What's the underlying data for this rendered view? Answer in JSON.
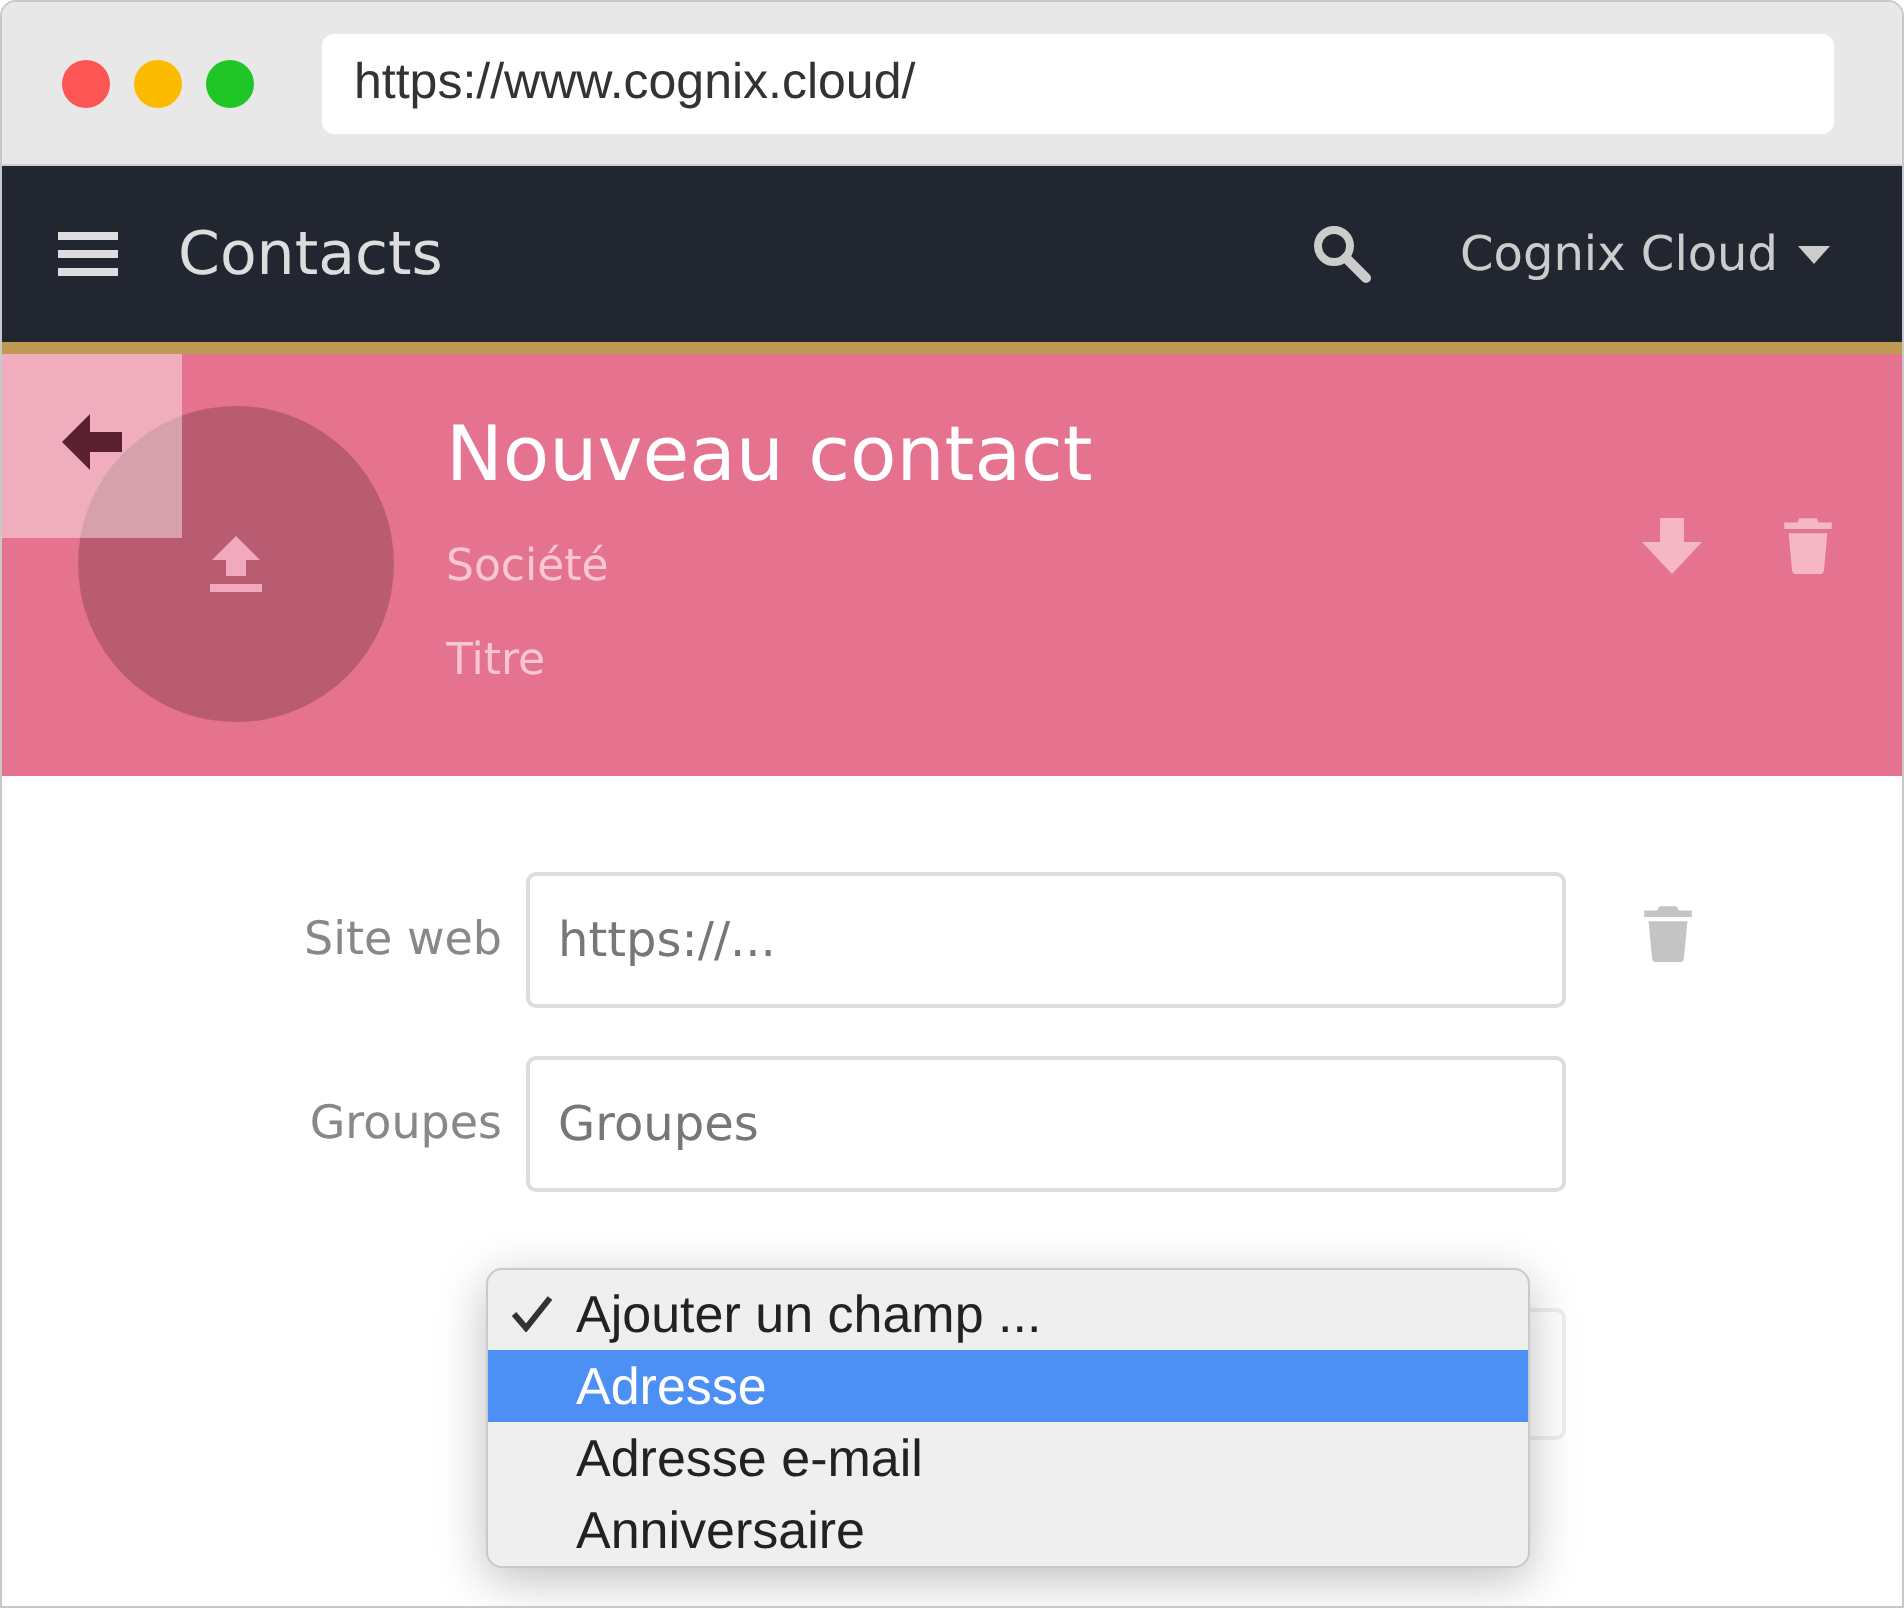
{
  "browser": {
    "url": "https://www.cognix.cloud/"
  },
  "navbar": {
    "title": "Contacts",
    "account": "Cognix Cloud"
  },
  "header": {
    "name": "Nouveau contact",
    "company_placeholder": "Société",
    "title_placeholder": "Titre"
  },
  "fields": [
    {
      "label": "Site web",
      "placeholder": "https://...",
      "deletable": true
    },
    {
      "label": "Groupes",
      "placeholder": "Groupes",
      "deletable": false
    }
  ],
  "add_field_menu": {
    "options": [
      {
        "label": "Ajouter un champ ...",
        "checked": true,
        "selected": false
      },
      {
        "label": "Adresse",
        "checked": false,
        "selected": true
      },
      {
        "label": "Adresse e-mail",
        "checked": false,
        "selected": false
      },
      {
        "label": "Anniversaire",
        "checked": false,
        "selected": false
      }
    ]
  }
}
